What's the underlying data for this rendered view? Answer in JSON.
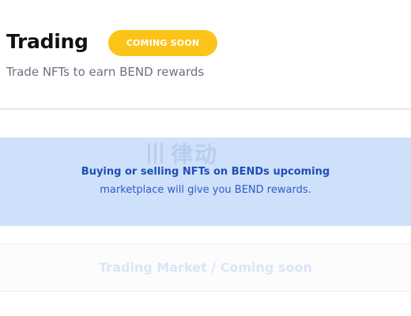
{
  "header": {
    "title": "Trading",
    "badge": "COMING SOON",
    "subtitle": "Trade NFTs to earn BEND rewards"
  },
  "info": {
    "line1": "Buying or selling NFTs on BENDs upcoming",
    "line2": "marketplace will give you BEND rewards.",
    "watermark": "律动"
  },
  "market": {
    "label": "Trading Market / Coming soon"
  },
  "colors": {
    "badge_bg": "#fcc419",
    "info_panel_bg": "#cfe0fb",
    "info_text": "#1e50b4",
    "market_text": "#dbe5f7"
  }
}
